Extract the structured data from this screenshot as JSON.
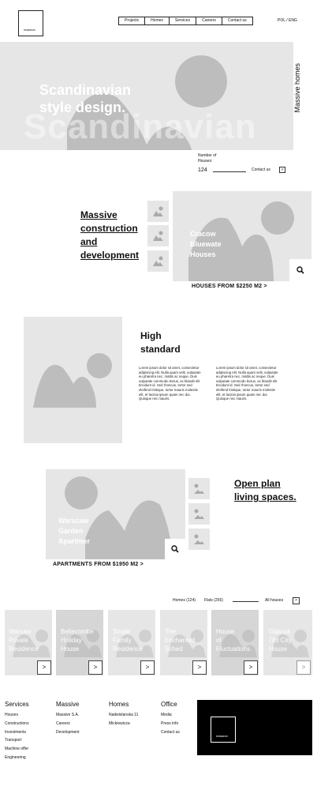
{
  "header": {
    "logo": "massive.",
    "nav": [
      "Projects",
      "Homes",
      "Services",
      "Careers",
      "Contact us"
    ],
    "lang": "POL / ENG"
  },
  "hero": {
    "title_line1": "Scandinavian",
    "title_line2": "style design.",
    "bg_text": "Scandinavian",
    "side_label": "Massive homes",
    "houses_label_1": "Number of",
    "houses_label_2": "Houses:",
    "houses_count": "124",
    "contact": "Contact us",
    "contact_arrow": ">"
  },
  "section1": {
    "heading": [
      "Massive",
      "construction",
      "and",
      "development"
    ],
    "overlay": [
      "Cracow",
      "Bluewate",
      "Houses"
    ],
    "caption": "HOUSES FROM $2250 M2 >"
  },
  "section2": {
    "heading": [
      "High",
      "standard"
    ],
    "lorem": "Lorem ipsum dolor sit amet, consectetur adipiscing elit. Nulla quam velit, vulputate eu pharetra nec, mattis ac neque. Duis vulputate commodo lectus, ac blandit elit tincidunt id. Sed rhoncus, tortor sed eleifend tristique, tortor mauris molestie elit, et lacinia ipsum quam nec dui. Quisque nec mauris."
  },
  "section3": {
    "heading": [
      "Open plan",
      "living spaces."
    ],
    "overlay": [
      "Warszaw",
      "Garden",
      "Apartmer"
    ],
    "caption": "APARTMENTS FROM $1950 M2 >"
  },
  "filter": {
    "homes": "Homes (124)",
    "flats": "Flats (256)",
    "all": "All houses",
    "arrow": ">"
  },
  "cards": [
    {
      "l1": "Warsaw",
      "l2": "Private",
      "l3": "Residence",
      "btn": ">"
    },
    {
      "l1": "Bellecombe",
      "l2": "Holiday",
      "l3": "House",
      "btn": ">"
    },
    {
      "l1": "Single",
      "l2": "Family",
      "l3": "Residence",
      "btn": ">"
    },
    {
      "l1": "The",
      "l2": "Enchanted",
      "l3": "Sched",
      "btn": ">"
    },
    {
      "l1": "House",
      "l2": "of",
      "l3": "Fluctuations",
      "btn": ">"
    },
    {
      "l1": "Gdansk",
      "l2": "Old City",
      "l3": "House",
      "btn": ">"
    }
  ],
  "footer": {
    "cols": [
      {
        "title": "Services",
        "items": [
          "Houses",
          "Constructions",
          "Investments",
          "Transport",
          "Machine offer",
          "Engineering"
        ]
      },
      {
        "title": "Massive",
        "items": [
          "Massive S.A.",
          "Careers",
          "Development"
        ]
      },
      {
        "title": "Homes",
        "items": [
          "Nadwislanska 11",
          "Mickiewicza"
        ]
      },
      {
        "title": "Office",
        "items": [
          "Media",
          "Press info",
          "Contact us"
        ]
      }
    ],
    "logo": "massive."
  }
}
